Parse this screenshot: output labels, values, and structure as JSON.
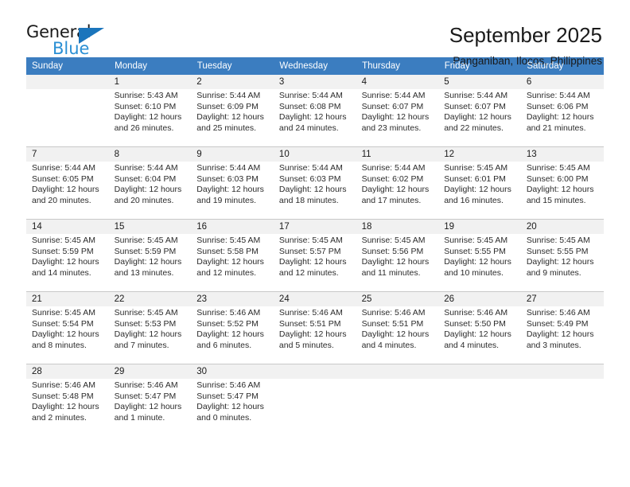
{
  "brand": {
    "name_part1": "General",
    "name_part2": "Blue",
    "accent_color": "#1b75bc",
    "accent_color_light": "#2a8fd4"
  },
  "header": {
    "title": "September 2025",
    "location": "Panganiban, Ilocos, Philippines"
  },
  "calendar": {
    "header_bg": "#3b7dc0",
    "daynum_bg": "#f1f1f1",
    "weekdays": [
      "Sunday",
      "Monday",
      "Tuesday",
      "Wednesday",
      "Thursday",
      "Friday",
      "Saturday"
    ],
    "weeks": [
      [
        {
          "day": "",
          "sunrise": "",
          "sunset": "",
          "daylight1": "",
          "daylight2": ""
        },
        {
          "day": "1",
          "sunrise": "Sunrise: 5:43 AM",
          "sunset": "Sunset: 6:10 PM",
          "daylight1": "Daylight: 12 hours",
          "daylight2": "and 26 minutes."
        },
        {
          "day": "2",
          "sunrise": "Sunrise: 5:44 AM",
          "sunset": "Sunset: 6:09 PM",
          "daylight1": "Daylight: 12 hours",
          "daylight2": "and 25 minutes."
        },
        {
          "day": "3",
          "sunrise": "Sunrise: 5:44 AM",
          "sunset": "Sunset: 6:08 PM",
          "daylight1": "Daylight: 12 hours",
          "daylight2": "and 24 minutes."
        },
        {
          "day": "4",
          "sunrise": "Sunrise: 5:44 AM",
          "sunset": "Sunset: 6:07 PM",
          "daylight1": "Daylight: 12 hours",
          "daylight2": "and 23 minutes."
        },
        {
          "day": "5",
          "sunrise": "Sunrise: 5:44 AM",
          "sunset": "Sunset: 6:07 PM",
          "daylight1": "Daylight: 12 hours",
          "daylight2": "and 22 minutes."
        },
        {
          "day": "6",
          "sunrise": "Sunrise: 5:44 AM",
          "sunset": "Sunset: 6:06 PM",
          "daylight1": "Daylight: 12 hours",
          "daylight2": "and 21 minutes."
        }
      ],
      [
        {
          "day": "7",
          "sunrise": "Sunrise: 5:44 AM",
          "sunset": "Sunset: 6:05 PM",
          "daylight1": "Daylight: 12 hours",
          "daylight2": "and 20 minutes."
        },
        {
          "day": "8",
          "sunrise": "Sunrise: 5:44 AM",
          "sunset": "Sunset: 6:04 PM",
          "daylight1": "Daylight: 12 hours",
          "daylight2": "and 20 minutes."
        },
        {
          "day": "9",
          "sunrise": "Sunrise: 5:44 AM",
          "sunset": "Sunset: 6:03 PM",
          "daylight1": "Daylight: 12 hours",
          "daylight2": "and 19 minutes."
        },
        {
          "day": "10",
          "sunrise": "Sunrise: 5:44 AM",
          "sunset": "Sunset: 6:03 PM",
          "daylight1": "Daylight: 12 hours",
          "daylight2": "and 18 minutes."
        },
        {
          "day": "11",
          "sunrise": "Sunrise: 5:44 AM",
          "sunset": "Sunset: 6:02 PM",
          "daylight1": "Daylight: 12 hours",
          "daylight2": "and 17 minutes."
        },
        {
          "day": "12",
          "sunrise": "Sunrise: 5:45 AM",
          "sunset": "Sunset: 6:01 PM",
          "daylight1": "Daylight: 12 hours",
          "daylight2": "and 16 minutes."
        },
        {
          "day": "13",
          "sunrise": "Sunrise: 5:45 AM",
          "sunset": "Sunset: 6:00 PM",
          "daylight1": "Daylight: 12 hours",
          "daylight2": "and 15 minutes."
        }
      ],
      [
        {
          "day": "14",
          "sunrise": "Sunrise: 5:45 AM",
          "sunset": "Sunset: 5:59 PM",
          "daylight1": "Daylight: 12 hours",
          "daylight2": "and 14 minutes."
        },
        {
          "day": "15",
          "sunrise": "Sunrise: 5:45 AM",
          "sunset": "Sunset: 5:59 PM",
          "daylight1": "Daylight: 12 hours",
          "daylight2": "and 13 minutes."
        },
        {
          "day": "16",
          "sunrise": "Sunrise: 5:45 AM",
          "sunset": "Sunset: 5:58 PM",
          "daylight1": "Daylight: 12 hours",
          "daylight2": "and 12 minutes."
        },
        {
          "day": "17",
          "sunrise": "Sunrise: 5:45 AM",
          "sunset": "Sunset: 5:57 PM",
          "daylight1": "Daylight: 12 hours",
          "daylight2": "and 12 minutes."
        },
        {
          "day": "18",
          "sunrise": "Sunrise: 5:45 AM",
          "sunset": "Sunset: 5:56 PM",
          "daylight1": "Daylight: 12 hours",
          "daylight2": "and 11 minutes."
        },
        {
          "day": "19",
          "sunrise": "Sunrise: 5:45 AM",
          "sunset": "Sunset: 5:55 PM",
          "daylight1": "Daylight: 12 hours",
          "daylight2": "and 10 minutes."
        },
        {
          "day": "20",
          "sunrise": "Sunrise: 5:45 AM",
          "sunset": "Sunset: 5:55 PM",
          "daylight1": "Daylight: 12 hours",
          "daylight2": "and 9 minutes."
        }
      ],
      [
        {
          "day": "21",
          "sunrise": "Sunrise: 5:45 AM",
          "sunset": "Sunset: 5:54 PM",
          "daylight1": "Daylight: 12 hours",
          "daylight2": "and 8 minutes."
        },
        {
          "day": "22",
          "sunrise": "Sunrise: 5:45 AM",
          "sunset": "Sunset: 5:53 PM",
          "daylight1": "Daylight: 12 hours",
          "daylight2": "and 7 minutes."
        },
        {
          "day": "23",
          "sunrise": "Sunrise: 5:46 AM",
          "sunset": "Sunset: 5:52 PM",
          "daylight1": "Daylight: 12 hours",
          "daylight2": "and 6 minutes."
        },
        {
          "day": "24",
          "sunrise": "Sunrise: 5:46 AM",
          "sunset": "Sunset: 5:51 PM",
          "daylight1": "Daylight: 12 hours",
          "daylight2": "and 5 minutes."
        },
        {
          "day": "25",
          "sunrise": "Sunrise: 5:46 AM",
          "sunset": "Sunset: 5:51 PM",
          "daylight1": "Daylight: 12 hours",
          "daylight2": "and 4 minutes."
        },
        {
          "day": "26",
          "sunrise": "Sunrise: 5:46 AM",
          "sunset": "Sunset: 5:50 PM",
          "daylight1": "Daylight: 12 hours",
          "daylight2": "and 4 minutes."
        },
        {
          "day": "27",
          "sunrise": "Sunrise: 5:46 AM",
          "sunset": "Sunset: 5:49 PM",
          "daylight1": "Daylight: 12 hours",
          "daylight2": "and 3 minutes."
        }
      ],
      [
        {
          "day": "28",
          "sunrise": "Sunrise: 5:46 AM",
          "sunset": "Sunset: 5:48 PM",
          "daylight1": "Daylight: 12 hours",
          "daylight2": "and 2 minutes."
        },
        {
          "day": "29",
          "sunrise": "Sunrise: 5:46 AM",
          "sunset": "Sunset: 5:47 PM",
          "daylight1": "Daylight: 12 hours",
          "daylight2": "and 1 minute."
        },
        {
          "day": "30",
          "sunrise": "Sunrise: 5:46 AM",
          "sunset": "Sunset: 5:47 PM",
          "daylight1": "Daylight: 12 hours",
          "daylight2": "and 0 minutes."
        },
        {
          "day": "",
          "sunrise": "",
          "sunset": "",
          "daylight1": "",
          "daylight2": ""
        },
        {
          "day": "",
          "sunrise": "",
          "sunset": "",
          "daylight1": "",
          "daylight2": ""
        },
        {
          "day": "",
          "sunrise": "",
          "sunset": "",
          "daylight1": "",
          "daylight2": ""
        },
        {
          "day": "",
          "sunrise": "",
          "sunset": "",
          "daylight1": "",
          "daylight2": ""
        }
      ]
    ]
  }
}
